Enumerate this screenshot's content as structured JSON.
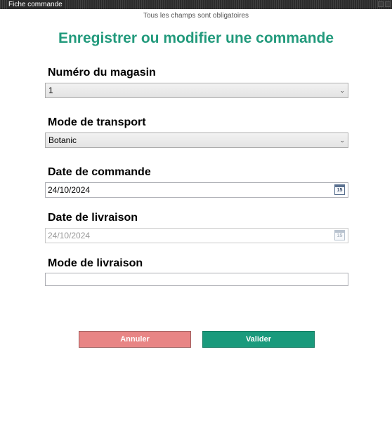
{
  "window": {
    "title": "Fiche commande"
  },
  "hint": "Tous les champs sont obligatoires",
  "heading": "Enregistrer ou modifier une commande",
  "fields": {
    "magasin": {
      "label": "Numéro du magasin",
      "value": "1"
    },
    "transport": {
      "label": "Mode de transport",
      "value": "Botanic"
    },
    "date_commande": {
      "label": "Date de commande",
      "value": "24/10/2024",
      "calendar_day": "15"
    },
    "date_livraison": {
      "label": "Date de livraison",
      "value": "24/10/2024",
      "calendar_day": "15",
      "enabled": false
    },
    "mode_livraison": {
      "label": "Mode de livraison",
      "value": ""
    }
  },
  "buttons": {
    "cancel": "Annuler",
    "ok": "Valider"
  },
  "colors": {
    "accent": "#229a7c",
    "cancel": "#e88585",
    "ok": "#1a9a7c"
  }
}
